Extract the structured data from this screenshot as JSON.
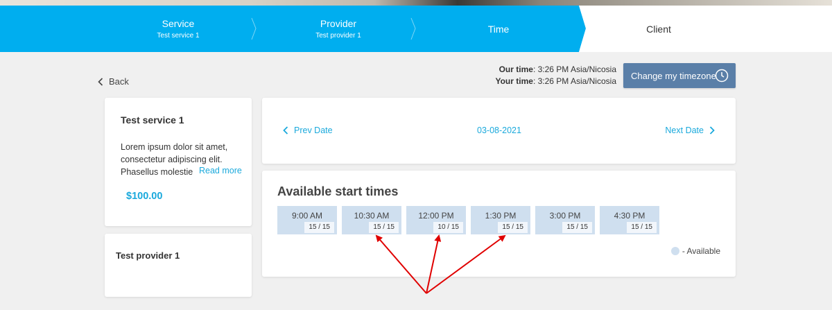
{
  "stepper": {
    "steps": [
      {
        "title": "Service",
        "subtitle": "Test service 1"
      },
      {
        "title": "Provider",
        "subtitle": "Test provider 1"
      },
      {
        "title": "Time",
        "subtitle": ""
      },
      {
        "title": "Client",
        "subtitle": ""
      }
    ],
    "active_color": "#00aeef"
  },
  "back_label": "Back",
  "timeinfo": {
    "our_label": "Our time",
    "our_value": ": 3:26 PM Asia/Nicosia",
    "your_label": "Your time",
    "your_value": ": 3:26 PM Asia/Nicosia"
  },
  "timezone_button": {
    "label": "Change my timezone",
    "icon": "clock-icon"
  },
  "service": {
    "title": "Test service 1",
    "description": "Lorem ipsum dolor sit amet, consectetur adipiscing elit. Phasellus molestie",
    "read_more": "Read more",
    "price": "$100.00"
  },
  "provider": {
    "title": "Test provider 1"
  },
  "date_nav": {
    "prev": "Prev Date",
    "date": "03-08-2021",
    "next": "Next Date"
  },
  "times": {
    "title": "Available start times",
    "slots": [
      {
        "time": "9:00 AM",
        "capacity": "15 / 15"
      },
      {
        "time": "10:30 AM",
        "capacity": "15 / 15"
      },
      {
        "time": "12:00 PM",
        "capacity": "10 / 15"
      },
      {
        "time": "1:30 PM",
        "capacity": "15 / 15"
      },
      {
        "time": "3:00 PM",
        "capacity": "15 / 15"
      },
      {
        "time": "4:30 PM",
        "capacity": "15 / 15"
      }
    ],
    "legend": "- Available"
  },
  "colors": {
    "accent": "#1aa9dc",
    "slot": "#cfdfef",
    "button": "#5a7fa8",
    "annotation": "#e00000"
  }
}
